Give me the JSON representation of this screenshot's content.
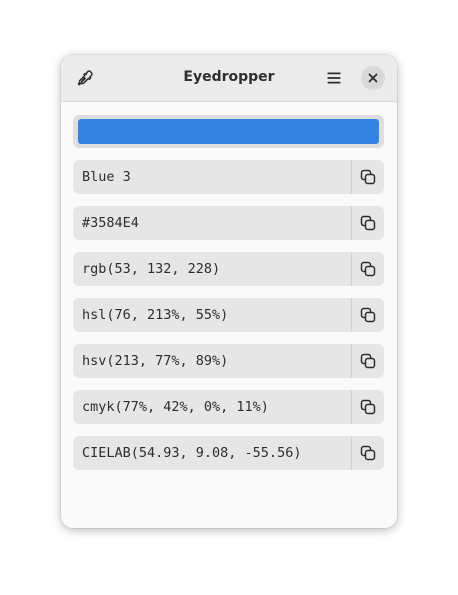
{
  "window": {
    "title": "Eyedropper"
  },
  "header": {
    "picker_icon": "color-picker-icon",
    "menu_icon": "hamburger-menu-icon",
    "close_icon": "close-icon"
  },
  "swatch": {
    "color": "#3584E4"
  },
  "colors": {
    "accent": "#3584E4",
    "copy_icon": "edit-copy-icon"
  },
  "formats": [
    {
      "name": "name",
      "value": "Blue 3"
    },
    {
      "name": "hex",
      "value": "#3584E4"
    },
    {
      "name": "rgb",
      "value": "rgb(53, 132, 228)"
    },
    {
      "name": "hsl",
      "value": "hsl(76, 213%, 55%)"
    },
    {
      "name": "hsv",
      "value": "hsv(213, 77%, 89%)"
    },
    {
      "name": "cmyk",
      "value": "cmyk(77%, 42%, 0%, 11%)"
    },
    {
      "name": "cielab",
      "value": "CIELAB(54.93, 9.08, -55.56)"
    }
  ]
}
